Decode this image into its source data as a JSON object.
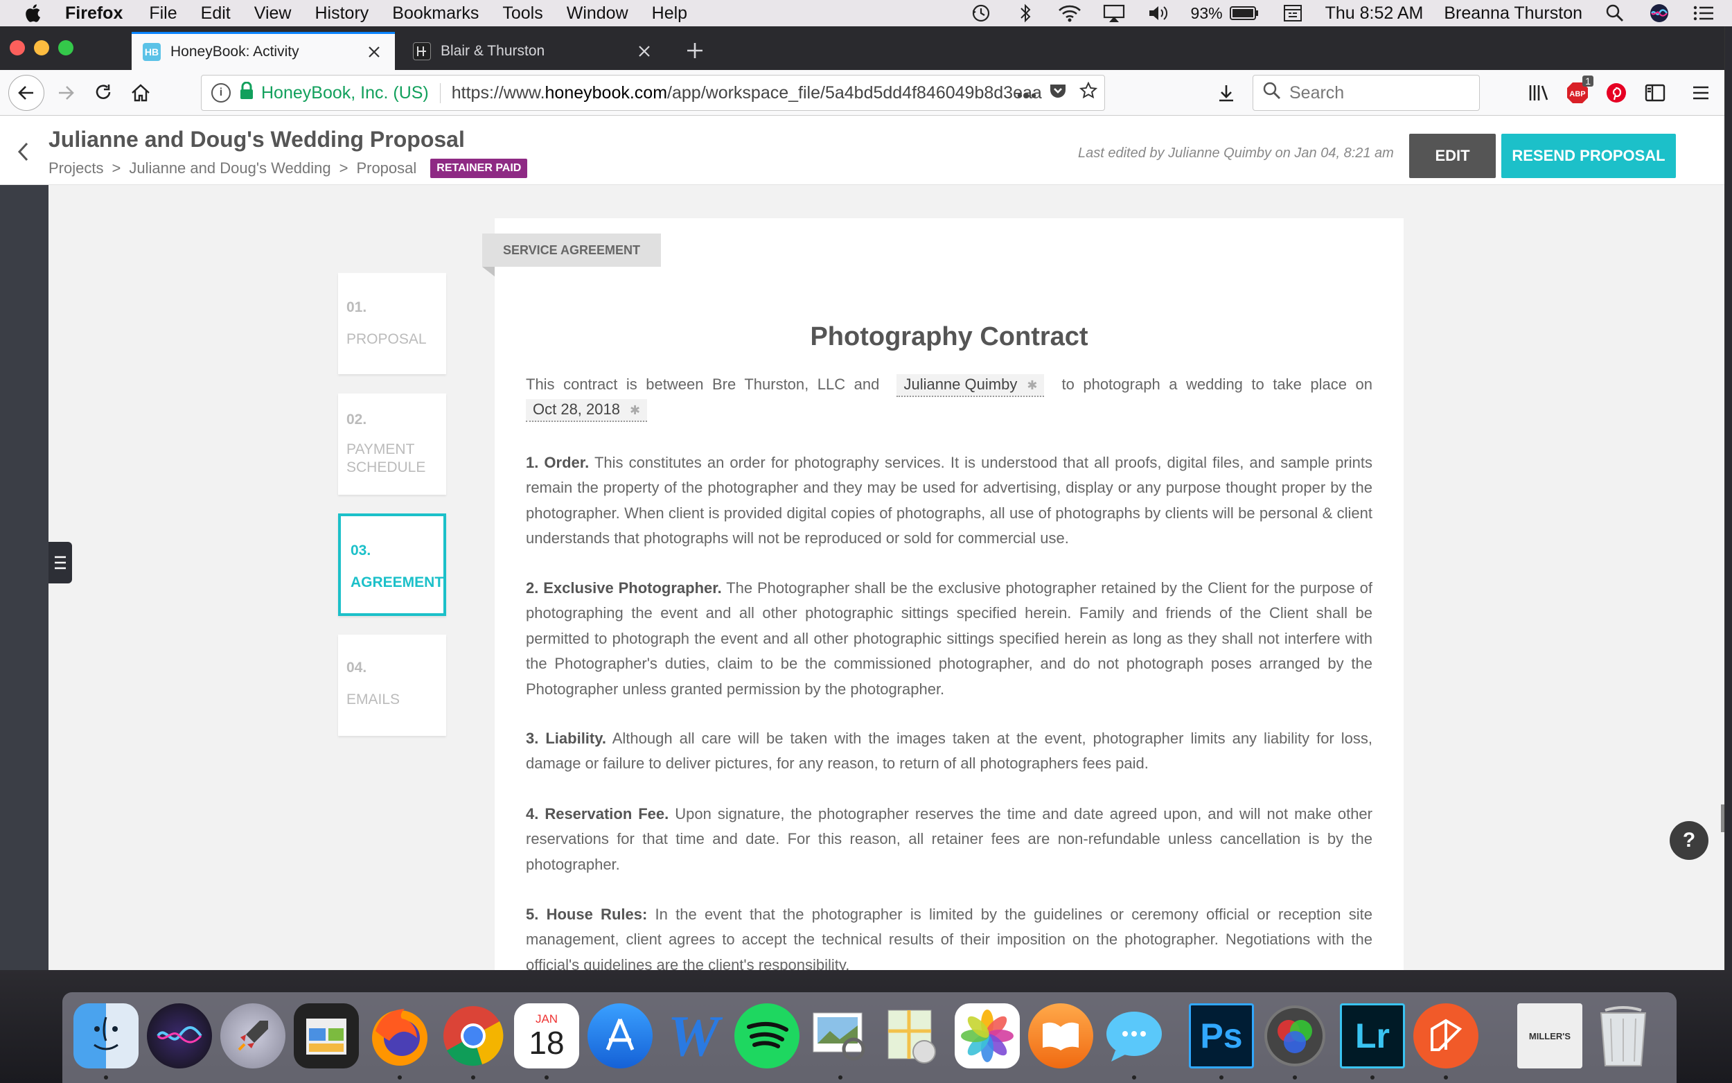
{
  "menubar": {
    "app_name": "Firefox",
    "menus": [
      "File",
      "Edit",
      "View",
      "History",
      "Bookmarks",
      "Tools",
      "Window",
      "Help"
    ],
    "battery": "93%",
    "clock": "Thu 8:52 AM",
    "user": "Breanna Thurston"
  },
  "browser": {
    "tabs": [
      {
        "title": "HoneyBook: Activity",
        "favicon": "HB"
      },
      {
        "title": "Blair & Thurston"
      }
    ],
    "identity": "HoneyBook, Inc. (US)",
    "url_prefix": "https://www.",
    "url_domain": "honeybook.com",
    "url_path": "/app/workspace_file/5a4bd5dd4f846049b8d3eaa",
    "search_placeholder": "Search",
    "abp_badge": "1"
  },
  "header": {
    "title": "Julianne and Doug's Wedding Proposal",
    "breadcrumb": [
      "Projects",
      "Julianne and Doug's Wedding",
      "Proposal"
    ],
    "breadcrumb_sep": ">",
    "status": "RETAINER PAID",
    "last_edited": "Last edited by Julianne Quimby on Jan 04, 8:21 am",
    "edit_label": "EDIT",
    "resend_label": "RESEND PROPOSAL"
  },
  "steps": [
    {
      "num": "01.",
      "label": "PROPOSAL"
    },
    {
      "num": "02.",
      "label": "PAYMENT SCHEDULE"
    },
    {
      "num": "03.",
      "label": "AGREEMENT"
    },
    {
      "num": "04.",
      "label": "EMAILS"
    }
  ],
  "document": {
    "tab_label": "SERVICE AGREEMENT",
    "title": "Photography Contract",
    "intro_pre": "This contract is between Bre Thurston, LLC and",
    "client_name": "Julianne Quimby",
    "intro_mid": "to photograph a wedding to take place on",
    "event_date": "Oct 28, 2018",
    "field_marker": "✱",
    "sections": [
      {
        "heading": "1. Order.",
        "text": "This constitutes an order for photography services. It is understood that all proofs, digital files, and sample prints remain the property of the photographer and they may be used for advertising, display or any purpose thought proper by the photographer. When client is provided digital copies of photographs, all use of photographs by clients will be personal & client understands that photographs will not be reproduced or sold for commercial use."
      },
      {
        "heading": "2. Exclusive Photographer.",
        "text": "The Photographer shall be the exclusive photographer retained by the Client for the purpose of photographing the event and all other photographic sittings specified herein. Family and friends of the Client shall be permitted to photograph the event and all other photographic sittings specified herein as long as they shall not interfere with the Photographer's duties, claim to be the commissioned photographer, and do not photograph poses arranged by the Photographer unless granted permission by the photographer."
      },
      {
        "heading": "3. Liability.",
        "text": "Although all care will be taken with the images taken at the event, photographer limits any liability for loss, damage or failure to deliver pictures, for any reason, to return of all photographers fees paid."
      },
      {
        "heading": "4. Reservation Fee.",
        "text": "Upon signature, the photographer reserves the time and date agreed upon, and will not make other reservations for that time and date. For this reason, all retainer fees are non-refundable unless cancellation is by the photographer."
      },
      {
        "heading": "5. House Rules:",
        "text": "In the event that the photographer is limited by the guidelines or ceremony official or reception site management, client agrees to accept the technical results of their imposition on the photographer. Negotiations with the official's guidelines are the client's responsibility."
      }
    ]
  },
  "help_label": "?",
  "dock": {
    "calendar_month": "JAN",
    "calendar_day": "18",
    "ps_label": "Ps",
    "lr_label": "Lr",
    "w_label": "W",
    "millers_label": "MILLER'S"
  },
  "colors": {
    "accent": "#1cc0c9",
    "badge": "#8e2a84",
    "identity_green": "#12a05c"
  }
}
